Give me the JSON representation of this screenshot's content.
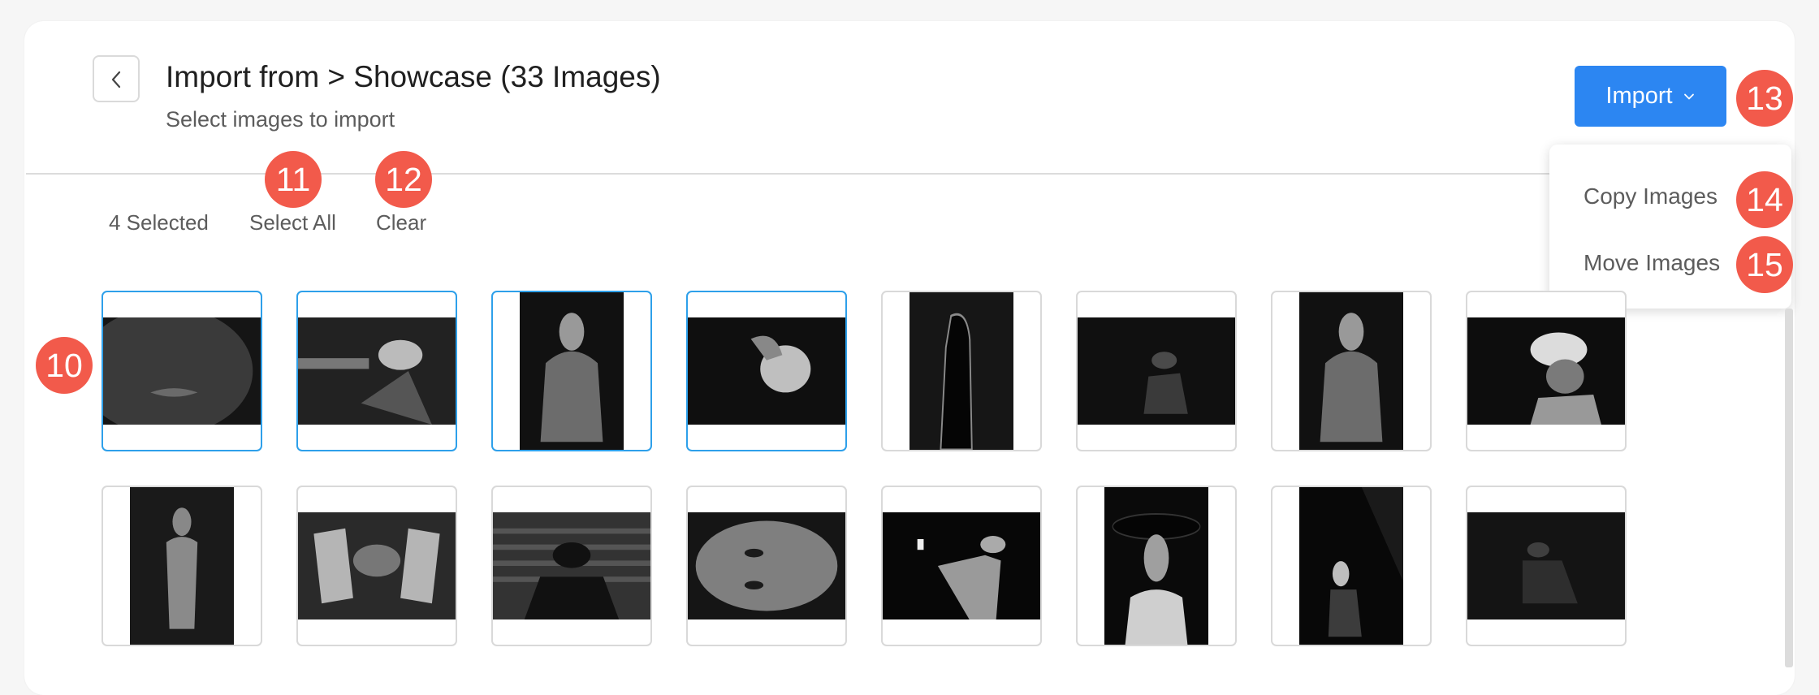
{
  "header": {
    "title": "Import from > Showcase (33 Images)",
    "subtitle": "Select images to import"
  },
  "selection": {
    "count_label": "4 Selected",
    "select_all_label": "Select All",
    "clear_label": "Clear"
  },
  "import_button": {
    "label": "Import",
    "color": "#2c86f2"
  },
  "import_menu": {
    "items": [
      {
        "label": "Copy Images"
      },
      {
        "label": "Move Images"
      }
    ]
  },
  "annotations": {
    "grid": "10",
    "select_all": "11",
    "clear": "12",
    "import": "13",
    "copy": "14",
    "move": "15",
    "color": "#f25a4b"
  },
  "grid": {
    "rows": [
      [
        {
          "subject": "lips-close-up",
          "orientation": "landscape",
          "selected": true
        },
        {
          "subject": "person-aiming-gun",
          "orientation": "landscape",
          "selected": true
        },
        {
          "subject": "man-in-jacket",
          "orientation": "portrait",
          "selected": true
        },
        {
          "subject": "woman-hand-in-hair",
          "orientation": "landscape",
          "selected": true
        },
        {
          "subject": "silhouette-backlit",
          "orientation": "portrait",
          "selected": false
        },
        {
          "subject": "shadowed-figure",
          "orientation": "landscape",
          "selected": false
        },
        {
          "subject": "man-in-jacket",
          "orientation": "portrait",
          "selected": false
        },
        {
          "subject": "woman-head-wrap",
          "orientation": "landscape",
          "selected": false
        }
      ],
      [
        {
          "subject": "bare-back-figure",
          "orientation": "portrait",
          "selected": false
        },
        {
          "subject": "hands-over-face",
          "orientation": "landscape",
          "selected": false
        },
        {
          "subject": "man-before-blinds",
          "orientation": "landscape",
          "selected": false
        },
        {
          "subject": "face-tilted",
          "orientation": "landscape",
          "selected": false
        },
        {
          "subject": "figure-reaching-light",
          "orientation": "landscape",
          "selected": false
        },
        {
          "subject": "woman-wide-hat",
          "orientation": "portrait",
          "selected": false
        },
        {
          "subject": "seated-man-lit",
          "orientation": "portrait",
          "selected": false
        },
        {
          "subject": "seated-figure-dim",
          "orientation": "landscape",
          "selected": false
        }
      ]
    ],
    "selected_border_color": "#2ea0ea"
  }
}
